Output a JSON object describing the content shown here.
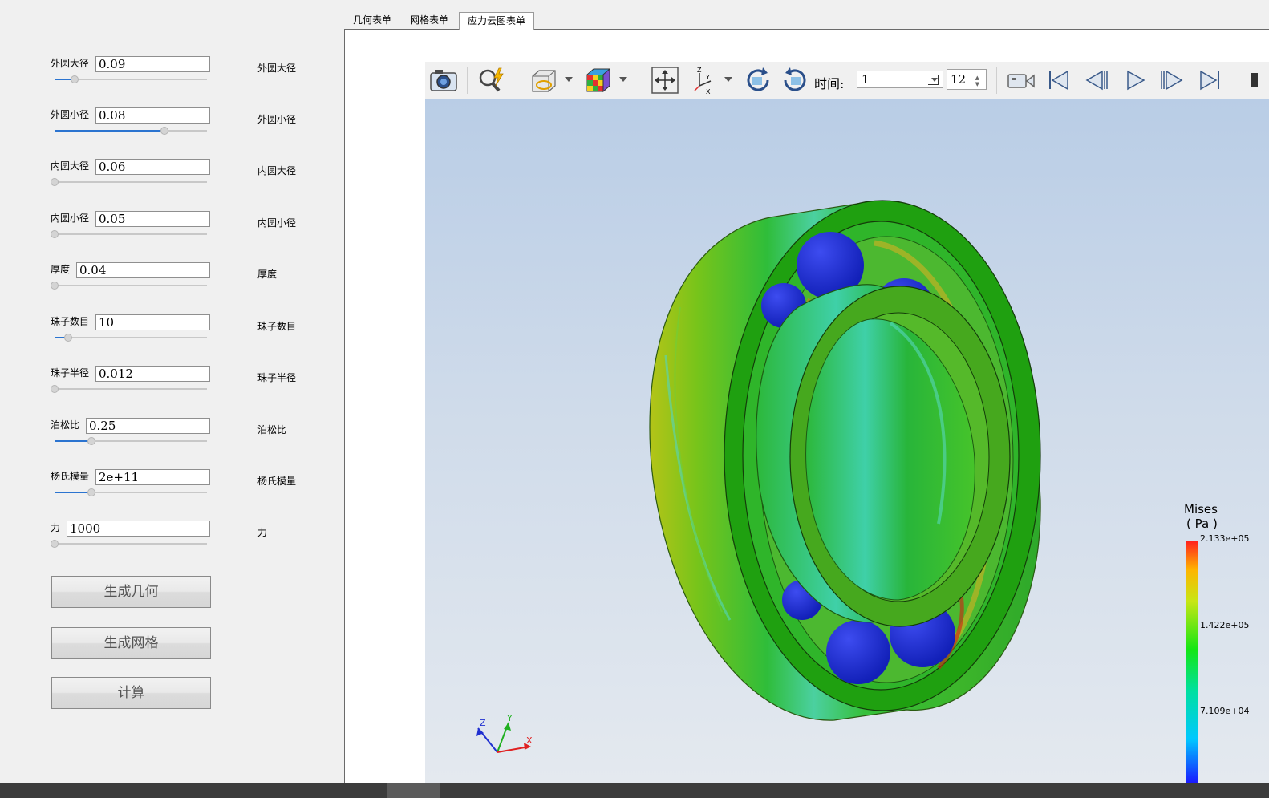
{
  "tabs": [
    "几何表单",
    "网格表单",
    "应力云图表单"
  ],
  "active_tab": 2,
  "params": [
    {
      "label": "外圆大径",
      "value": "0.09",
      "right_label": "外圆大径",
      "slider": 0.13
    },
    {
      "label": "外圆小径",
      "value": "0.08",
      "right_label": "外圆小径",
      "slider": 0.72
    },
    {
      "label": "内圆大径",
      "value": "0.06",
      "right_label": "内圆大径",
      "slider": 0.0
    },
    {
      "label": "内圆小径",
      "value": "0.05",
      "right_label": "内圆小径",
      "slider": 0.0
    },
    {
      "label": "厚度",
      "value": "0.04",
      "right_label": "厚度",
      "slider": 0.0
    },
    {
      "label": "珠子数目",
      "value": "10",
      "right_label": "珠子数目",
      "slider": 0.09
    },
    {
      "label": "珠子半径",
      "value": "0.012",
      "right_label": "珠子半径",
      "slider": 0.0
    },
    {
      "label": "泊松比",
      "value": "0.25",
      "right_label": "泊松比",
      "slider": 0.24
    },
    {
      "label": "杨氏模量",
      "value": "2e+11",
      "right_label": "杨氏模量",
      "slider": 0.24
    },
    {
      "label": "力",
      "value": "1000",
      "right_label": "力",
      "slider": 0.0
    }
  ],
  "buttons": {
    "geometry": "生成几何",
    "mesh": "生成网格",
    "compute": "计算"
  },
  "toolbar": {
    "time_label": "时间:",
    "time_value": "1",
    "frame_count": "12"
  },
  "legend": {
    "title": "Mises",
    "unit": "( Pa )",
    "max": "2.133e+05",
    "mid": "1.422e+05",
    "low": "7.109e+04"
  },
  "triad": {
    "x": "X",
    "y": "Y",
    "z": "Z"
  },
  "colors": {
    "accent": "#2b74d0",
    "ring": "#1f9a10",
    "ball": "#1f2fd0"
  }
}
